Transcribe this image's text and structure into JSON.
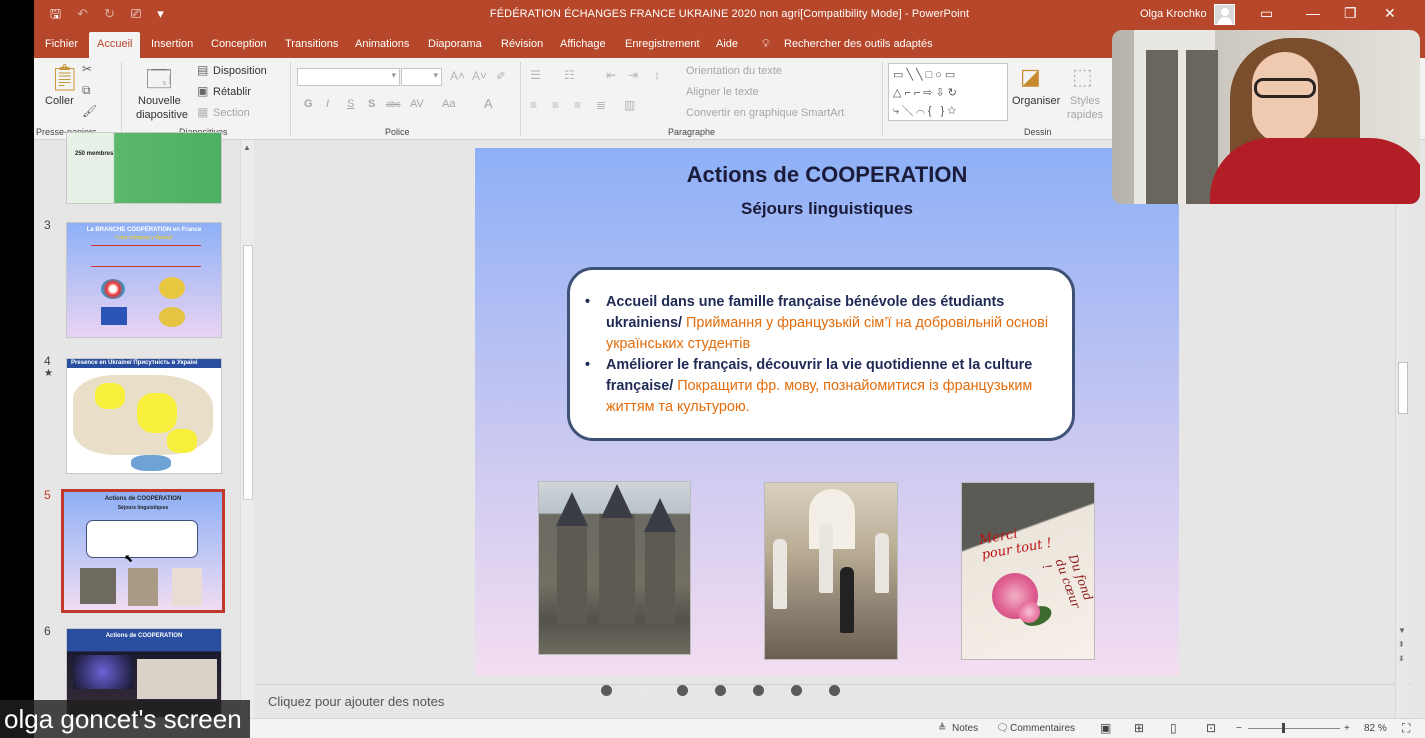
{
  "window": {
    "doc_title": "FÉDÉRATION ÉCHANGES FRANCE UKRAINE 2020 non agri[Compatibility Mode]  -  PowerPoint",
    "user_name": "Olga Krochko",
    "qat_icons": [
      "save-icon",
      "undo-icon",
      "redo-icon",
      "present-icon",
      "customize-icon"
    ]
  },
  "tabs": [
    "Fichier",
    "Accueil",
    "Insertion",
    "Conception",
    "Transitions",
    "Animations",
    "Diaporama",
    "Révision",
    "Affichage",
    "Enregistrement",
    "Aide"
  ],
  "active_tab": "Accueil",
  "tell_me": "Rechercher des outils adaptés",
  "ribbon": {
    "paste": "Coller",
    "clipboard_group": "Presse-papiers",
    "new_slide_1": "Nouvelle",
    "new_slide_2": "diapositive",
    "layout": "Disposition",
    "reset": "Rétablir",
    "section": "Section",
    "slides_group": "Diapositives",
    "font_group": "Police",
    "bold": "G",
    "italic": "I",
    "underline": "S",
    "shadow": "S",
    "strike": "abc",
    "spacing": "AV",
    "case": "Aa",
    "color": "A",
    "text_direction": "Orientation du texte",
    "align_text": "Aligner le texte",
    "smartart": "Convertir en graphique SmartArt",
    "paragraph_group": "Paragraphe",
    "arrange": "Organiser",
    "quick_styles_1": "Styles",
    "quick_styles_2": "rapides",
    "drawing_group": "Dessin"
  },
  "thumbnails": [
    {
      "num": "",
      "caption": "250 membres"
    },
    {
      "num": "3",
      "title": "La BRANCHE COOPÉRATION en France",
      "subtitle": "Гілка співпраці у Франції"
    },
    {
      "num": "4",
      "title": "Presence en Ukraine/ Присутність в Україні",
      "star": "★"
    },
    {
      "num": "5",
      "title": "Actions de COOPERATION",
      "subtitle": "Séjours linguistiques"
    },
    {
      "num": "6",
      "title": "Actions de COOPERATION"
    }
  ],
  "slide": {
    "title": "Actions de COOPERATION",
    "subtitle": "Séjours linguistiques",
    "bullets": [
      {
        "fr": "Accueil dans une famille française bénévole des étudiants ukrainiens/ ",
        "ua": "Приймання у французькій сім’ї на добровільній основі українських студентів"
      },
      {
        "fr": "Améliorer le français, découvrir la vie quotidienne et la culture française/ ",
        "ua": "Покращити фр. мову, познайомитися із французьким життям та культурою."
      }
    ],
    "card_text_1": "Merci",
    "card_text_2": "pour tout !",
    "card_text_3": "Du fond du cœur !"
  },
  "notes_placeholder": "Cliquez pour ajouter des notes",
  "status": {
    "notes": "Notes",
    "comments": "Commentaires",
    "zoom_minus": "−",
    "zoom_plus": "+",
    "zoom_level": "82 %"
  },
  "share_label": "olga goncet's screen",
  "colors": {
    "brand": "#b7472a",
    "accent_text": "#1f2a55",
    "ukrainian_text": "#e46c0a",
    "active_thumb": "#c0392b"
  }
}
